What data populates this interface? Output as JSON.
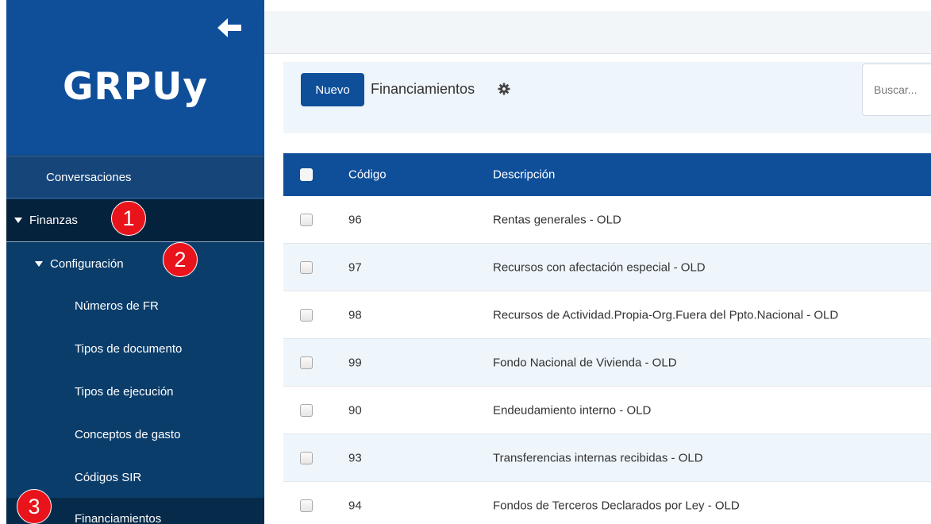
{
  "app": {
    "logo": "GRPUy"
  },
  "sidebar": {
    "conversations": "Conversaciones",
    "finanzas": "Finanzas",
    "configuracion": "Configuración",
    "items": [
      {
        "label": "Números de FR"
      },
      {
        "label": "Tipos de documento"
      },
      {
        "label": "Tipos de ejecución"
      },
      {
        "label": "Conceptos de gasto"
      },
      {
        "label": "Códigos SIR"
      },
      {
        "label": "Financiamientos"
      }
    ]
  },
  "badges": {
    "one": "1",
    "two": "2",
    "three": "3"
  },
  "header": {
    "new_button": "Nuevo",
    "title": "Financiamientos",
    "search_placeholder": "Buscar..."
  },
  "table": {
    "columns": {
      "code": "Código",
      "description": "Descripción"
    },
    "rows": [
      {
        "code": "96",
        "description": "Rentas generales - OLD"
      },
      {
        "code": "97",
        "description": "Recursos con afectación especial - OLD"
      },
      {
        "code": "98",
        "description": "Recursos de Actividad.Propia-Org.Fuera del Ppto.Nacional - OLD"
      },
      {
        "code": "99",
        "description": "Fondo Nacional de Vivienda - OLD"
      },
      {
        "code": "90",
        "description": "Endeudamiento interno - OLD"
      },
      {
        "code": "93",
        "description": "Transferencias internas recibidas - OLD"
      },
      {
        "code": "94",
        "description": "Fondos de Terceros Declarados por Ley - OLD"
      }
    ]
  },
  "colors": {
    "brand": "#0f4f9a",
    "sidebar": "#0b3d6b",
    "badge": "#e8131b",
    "row_alt": "#eef5fb"
  },
  "icons": {
    "back": "arrow-left-icon",
    "settings": "gear-icon",
    "expand": "triangle-down-icon"
  }
}
